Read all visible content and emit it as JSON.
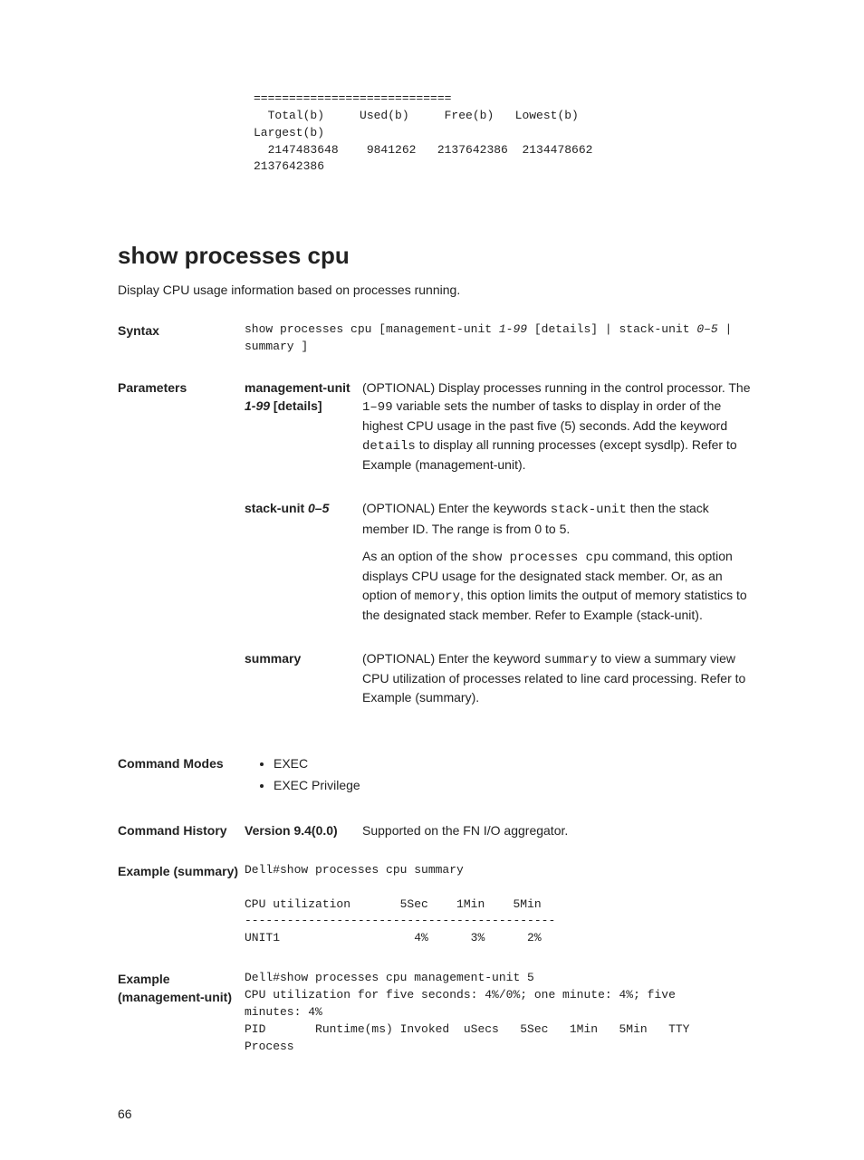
{
  "topBlock": "============================\n  Total(b)     Used(b)     Free(b)   Lowest(b)   \nLargest(b)\n  2147483648    9841262   2137642386  2134478662  \n2137642386",
  "section": {
    "title": "show processes cpu",
    "intro": "Display CPU usage information based on processes running."
  },
  "syntax": {
    "label": "Syntax",
    "part1": "show processes cpu [management-unit ",
    "part2_ital": "1-99",
    "part3": " [details] | stack-unit ",
    "part4_ital": "0–5",
    "part5": " | summary ]"
  },
  "parameters": {
    "label": "Parameters",
    "rows": [
      {
        "name_html": "management-unit <span class=\"ital\">1-99</span> [details]",
        "desc_html": "<p>(OPTIONAL) Display processes running in the control processor. The <span class=\"mono\">1–99</span> variable sets the number of tasks to display in order of the highest CPU usage in the past five (5) seconds. Add the keyword <span class=\"mono\">details</span> to display all running processes (except sysdlp). Refer to Example (management-unit).</p>"
      },
      {
        "name_html": "stack-unit <span class=\"ital\">0–5</span>",
        "desc_html": "<p>(OPTIONAL) Enter the keywords <span class=\"mono\">stack-unit</span> then the stack member ID. The range is from 0 to 5.</p><p>As an option of the <span class=\"mono\">show processes cpu</span> command, this option displays CPU usage for the designated stack member. Or, as an option of <span class=\"mono\">memory</span>, this option limits the output of memory statistics to the designated stack member. Refer to Example (stack-unit).</p>"
      },
      {
        "name_html": "summary",
        "desc_html": "<p>(OPTIONAL) Enter the keyword <span class=\"mono\">summary</span> to view a summary view CPU utilization of processes related to line card processing. Refer to Example (summary).</p>"
      }
    ]
  },
  "commandModes": {
    "label": "Command Modes",
    "items": [
      "EXEC",
      "EXEC Privilege"
    ]
  },
  "commandHistory": {
    "label": "Command History",
    "version": "Version 9.4(0.0)",
    "desc": "Supported on the FN I/O aggregator."
  },
  "exampleSummary": {
    "label": "Example (summary)",
    "text": "Dell#show processes cpu summary\n \nCPU utilization       5Sec    1Min    5Min\n--------------------------------------------\nUNIT1                   4%      3%      2%"
  },
  "exampleMgmt": {
    "label": "Example (management-unit)",
    "text": "Dell#show processes cpu management-unit 5\nCPU utilization for five seconds: 4%/0%; one minute: 4%; five \nminutes: 4%\nPID       Runtime(ms) Invoked  uSecs   5Sec   1Min   5Min   TTY  \nProcess"
  },
  "pageNumber": "66"
}
